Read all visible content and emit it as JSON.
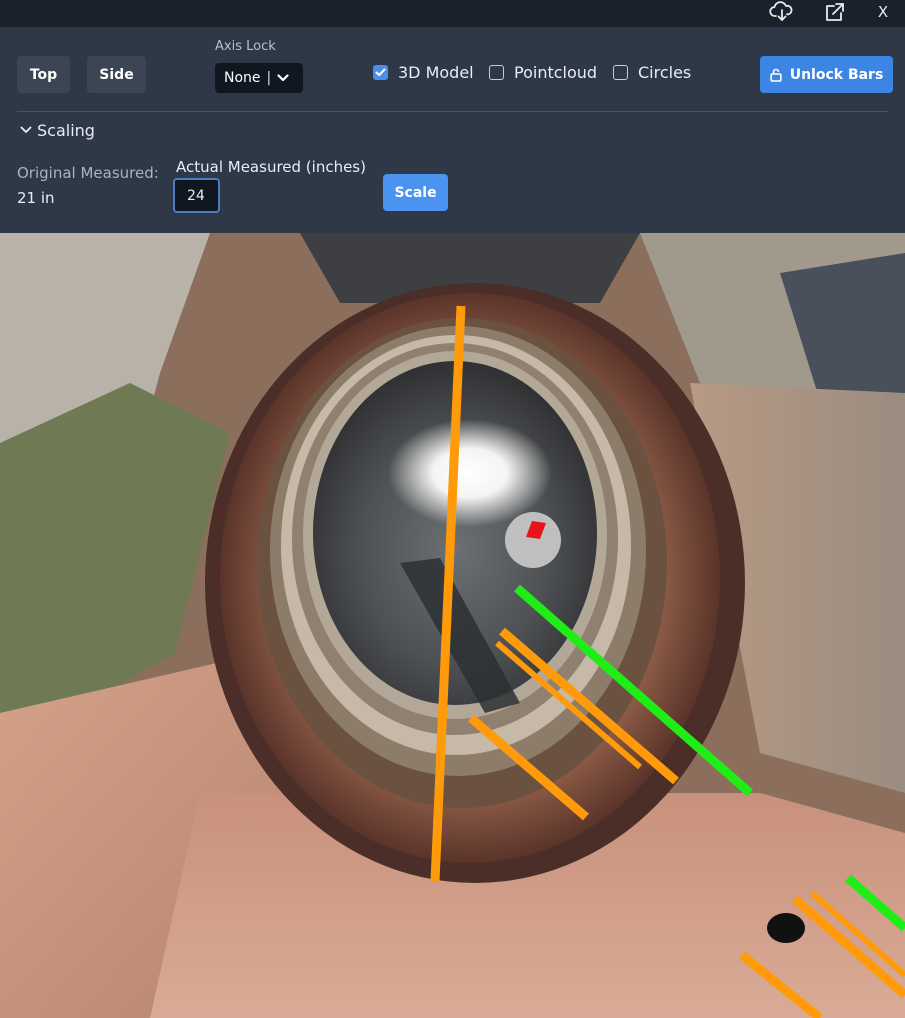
{
  "window": {
    "download_icon": "cloud-download-icon",
    "open_external_icon": "external-link-icon",
    "close_label": "X"
  },
  "toolbar": {
    "top_label": "Top",
    "side_label": "Side",
    "axis_lock": {
      "label": "Axis Lock",
      "value": "None",
      "separator": "|",
      "chevron_icon": "chevron-down-icon"
    },
    "toggles": [
      {
        "label": "3D Model",
        "checked": true
      },
      {
        "label": "Pointcloud",
        "checked": false
      },
      {
        "label": "Circles",
        "checked": false
      }
    ],
    "unlock_label": "Unlock Bars",
    "unlock_icon": "lock-icon"
  },
  "scaling": {
    "title": "Scaling",
    "expanded": true,
    "original_label": "Original Measured:",
    "original_value": "21 in",
    "actual_label": "Actual Measured (inches)",
    "actual_value": "24",
    "scale_label": "Scale"
  },
  "viewport": {
    "bar_colors": {
      "orange": "#ff9a0a",
      "green": "#1fee16"
    },
    "marker_color": "#e8141c",
    "marker_ring_color": "#bfbfbf"
  }
}
